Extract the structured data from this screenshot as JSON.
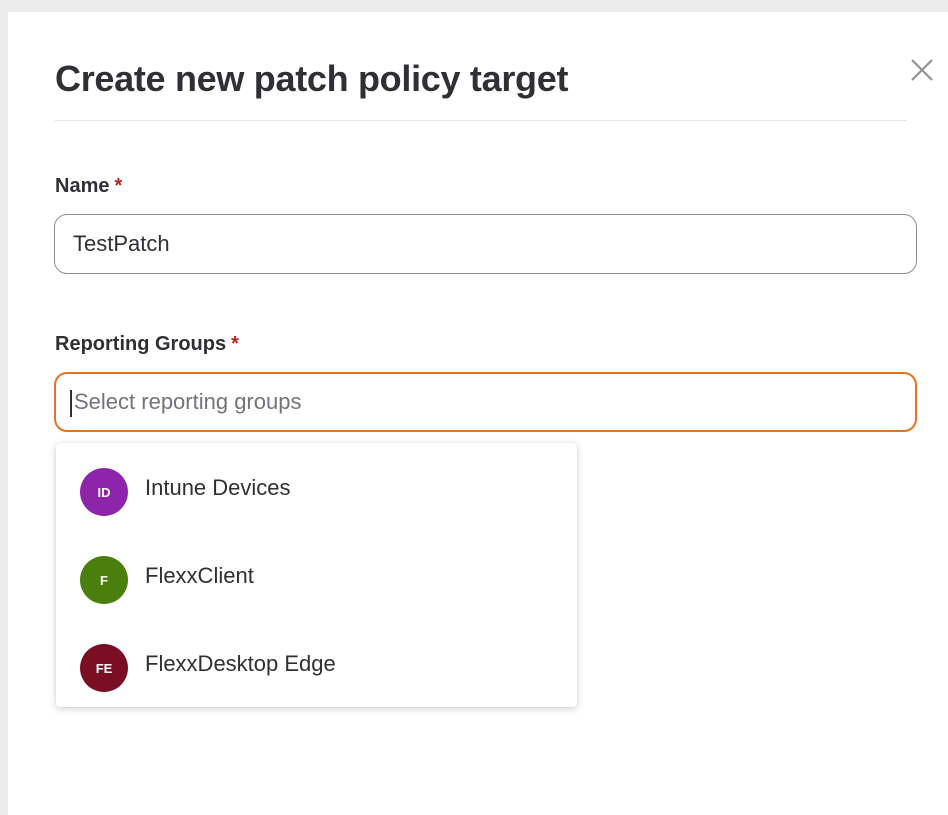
{
  "dialog": {
    "title": "Create new patch policy target",
    "close_icon": "close-icon"
  },
  "name_field": {
    "label": "Name",
    "required_marker": "*",
    "value": "TestPatch"
  },
  "groups_field": {
    "label": "Reporting Groups",
    "required_marker": "*",
    "value": "",
    "placeholder": "Select reporting groups",
    "focus_color": "#e8731c"
  },
  "dropdown": {
    "options": [
      {
        "initials": "ID",
        "label": "Intune Devices",
        "color": "#8e24aa"
      },
      {
        "initials": "F",
        "label": "FlexxClient",
        "color": "#4a7f0e"
      },
      {
        "initials": "FE",
        "label": "FlexxDesktop Edge",
        "color": "#7a0f24"
      }
    ]
  }
}
